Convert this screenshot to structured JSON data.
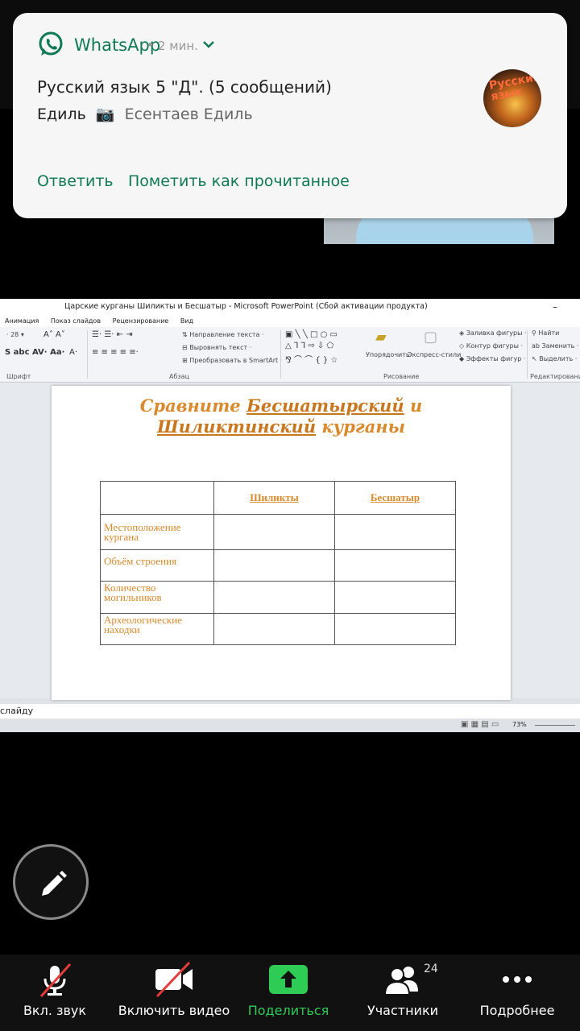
{
  "notification": {
    "app_name": "WhatsApp",
    "dot": "•",
    "time": "2 мин.",
    "title": "Русский язык 5 \"Д\". (5 сообщений)",
    "sender": "Едиль",
    "camera_glyph": "📷",
    "message": "Есентаев Едиль",
    "avatar_text": "Русский язык",
    "actions": [
      "Ответить",
      "Пометить как прочитанное"
    ],
    "accent": "#0f7a55"
  },
  "powerpoint": {
    "window_title": "Царские курганы Шиликты и Бесшатыр - Microsoft PowerPoint (Сбой активации продукта)",
    "minimize": "–",
    "menu": [
      "Анимация",
      "Показ слайдов",
      "Рецензирование",
      "Вид"
    ],
    "ribbon": {
      "font_size": "28",
      "text_direction": "Направление текста",
      "align_text": "Выровнять текст",
      "smartart": "Преобразовать в SmartArt",
      "arrange": "Упорядочить",
      "quick_styles": "Экспресс-стили",
      "fill": "Заливка фигуры",
      "outline": "Контур фигуры",
      "effects": "Эффекты фигур",
      "find": "Найти",
      "replace": "Заменить",
      "select": "Выделить",
      "groups": [
        "Шрифт",
        "Абзац",
        "Рисование",
        "Редактирование"
      ]
    },
    "slide": {
      "title_line1_pre": "Сравните ",
      "title_line1_u": "Бесшатырский",
      "title_line1_post": " и",
      "title_line2_u": "Шиликтинский",
      "title_line2_post": " курганы",
      "table": {
        "headers": [
          "",
          "Шиликты",
          "Бесшатыр"
        ],
        "rows": [
          "Местоположение кургана",
          "Объём строения",
          "Количество могильников",
          "Археологические находки"
        ]
      },
      "accent": "#d98a2c"
    },
    "notes_text": "слайду",
    "zoom_level": "73%"
  },
  "toolbar": {
    "items": [
      {
        "label": "Вкл. звук"
      },
      {
        "label": "Включить видео"
      },
      {
        "label": "Поделиться"
      },
      {
        "label": "Участники",
        "count": "24"
      },
      {
        "label": "Подробнее"
      }
    ],
    "share_color": "#2ecc55"
  }
}
